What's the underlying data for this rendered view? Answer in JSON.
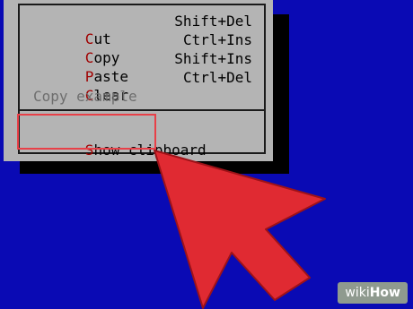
{
  "menu": {
    "items": [
      {
        "hotkey": "C",
        "rest": "ut",
        "shortcut": "Shift+Del",
        "enabled": true
      },
      {
        "hotkey": "C",
        "rest": "opy",
        "shortcut": "Ctrl+Ins",
        "enabled": true
      },
      {
        "hotkey": "P",
        "rest": "aste",
        "shortcut": "Shift+Ins",
        "enabled": true
      },
      {
        "hotkey": "C",
        "rest": "lear",
        "shortcut": "Ctrl+Del",
        "enabled": true
      }
    ],
    "disabled_item": "Copy example",
    "show_clipboard": {
      "hotkey": "S",
      "rest": "how clipboard"
    }
  },
  "watermark": {
    "prefix": "wiki",
    "suffix": "How"
  },
  "colors": {
    "desktop": "#0a0ab4",
    "menu": "#b4b4b4",
    "hotkey": "#a00000",
    "disabled": "#6e6e6e",
    "highlight_box": "#e84048",
    "arrow": "#e02a32"
  },
  "icons": {
    "pointer": "red-arrow-icon"
  }
}
